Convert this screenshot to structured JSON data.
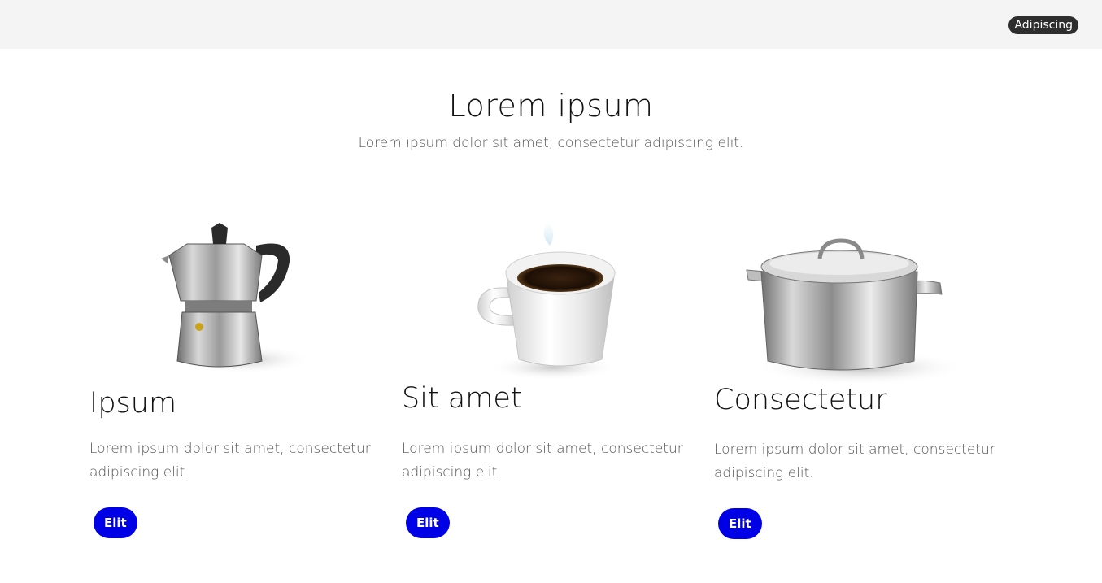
{
  "header": {
    "nav_link": "Adipiscing"
  },
  "hero": {
    "title": "Lorem ipsum",
    "subtitle": "Lorem ipsum dolor sit amet, consectetur adipiscing elit."
  },
  "cards": [
    {
      "image": "moka-pot-image",
      "title": "Ipsum",
      "text": "Lorem ipsum dolor sit amet, consectetur adipiscing elit.",
      "button": "Elit"
    },
    {
      "image": "coffee-cup-image",
      "title": "Sit amet",
      "text": "Lorem ipsum dolor sit amet, consectetur adipiscing elit.",
      "button": "Elit"
    },
    {
      "image": "cooking-pot-image",
      "title": "Consectetur",
      "text": "Lorem ipsum dolor sit amet, consectetur adipiscing elit.",
      "button": "Elit"
    }
  ],
  "colors": {
    "header_bg": "#f4f4f4",
    "nav_pill_bg": "#2e2e2e",
    "button_bg": "#0000e6"
  }
}
